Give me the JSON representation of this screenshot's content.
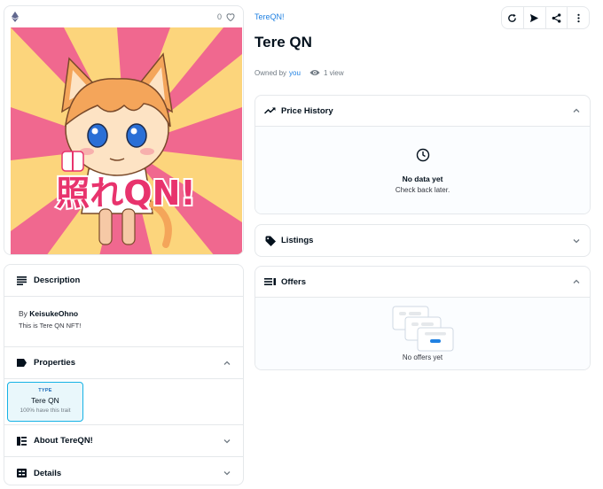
{
  "nft": {
    "collection": "TereQN!",
    "title": "Tere QN",
    "owned_by_label": "Owned by",
    "owner": "you",
    "views": "1 view",
    "favorites": "0",
    "artwork_text": "照れQN!"
  },
  "actions": [
    {
      "icon": "refresh-icon"
    },
    {
      "icon": "send-icon"
    },
    {
      "icon": "share-icon"
    },
    {
      "icon": "more-icon"
    }
  ],
  "description": {
    "header": "Description",
    "by_label": "By",
    "creator": "KeisukeOhno",
    "text": "This is Tere QN NFT!"
  },
  "properties": {
    "header": "Properties",
    "traits": [
      {
        "type": "TYPE",
        "value": "Tere QN",
        "rarity": "100% have this trait"
      }
    ]
  },
  "about": {
    "header": "About TereQN!"
  },
  "details": {
    "header": "Details"
  },
  "price_history": {
    "header": "Price History",
    "empty_title": "No data yet",
    "empty_sub": "Check back later."
  },
  "listings": {
    "header": "Listings"
  },
  "offers": {
    "header": "Offers",
    "empty": "No offers yet"
  },
  "colors": {
    "accent": "#2081e2",
    "trait_border": "#15b2e5",
    "artwork_pink": "#f0688f",
    "artwork_yellow": "#fcd57c",
    "text_pink": "#e8336d"
  }
}
